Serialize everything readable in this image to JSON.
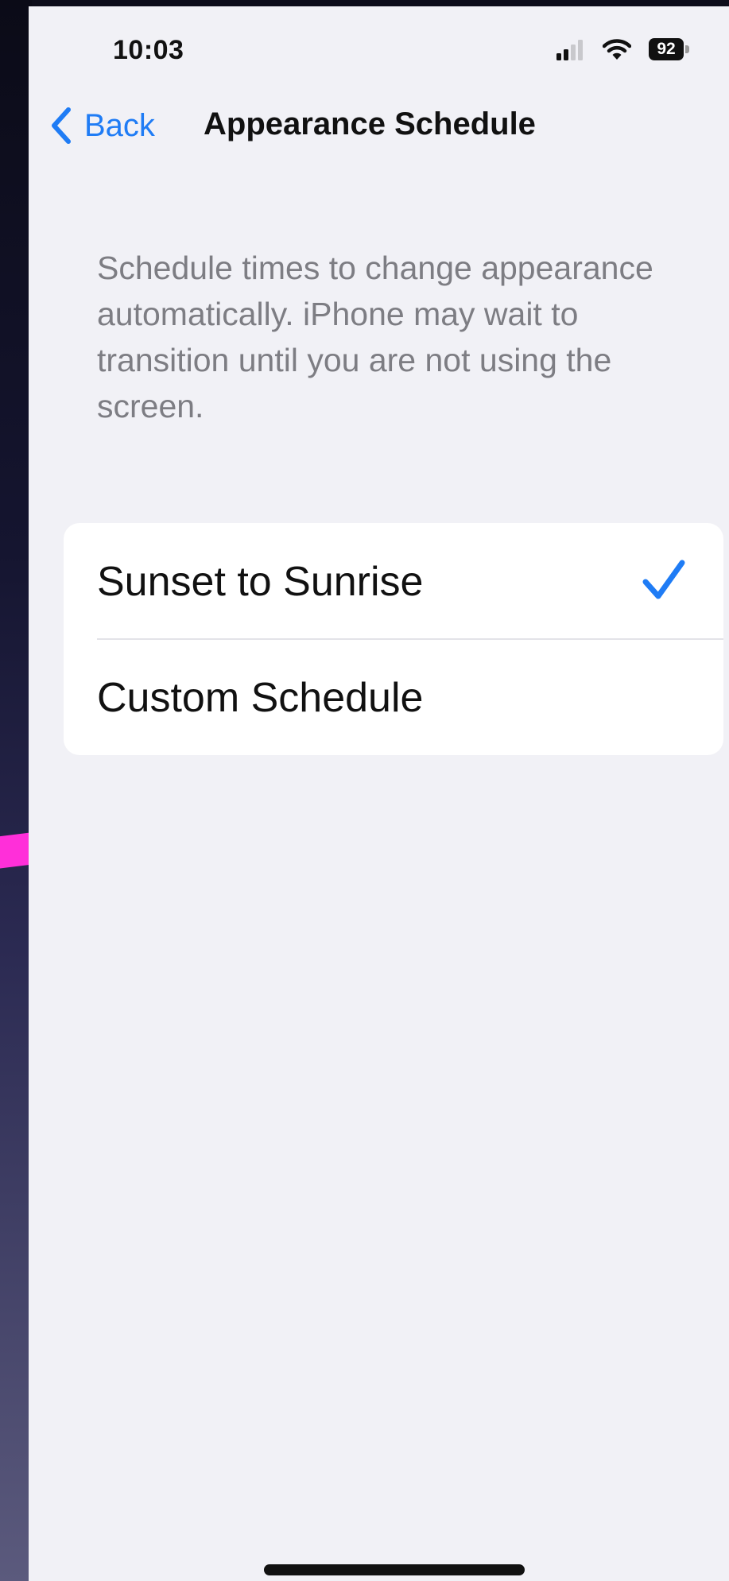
{
  "status_bar": {
    "time": "10:03",
    "battery_level": "92",
    "icons": [
      "signal-icon",
      "wifi-icon",
      "battery-icon"
    ]
  },
  "nav": {
    "back_label": "Back",
    "title": "Appearance Schedule",
    "back_icon": "chevron-left-icon"
  },
  "description": "Schedule times to change appearance automatically. iPhone may wait to transition until you are not using the screen.",
  "options": [
    {
      "label": "Sunset to Sunrise",
      "selected": true
    },
    {
      "label": "Custom Schedule",
      "selected": false
    }
  ],
  "colors": {
    "accent": "#1f7cf5",
    "background": "#f1f1f6",
    "card": "#ffffff",
    "secondary_text": "#7d7d83",
    "annotation_mark": "#ff2fd9"
  }
}
